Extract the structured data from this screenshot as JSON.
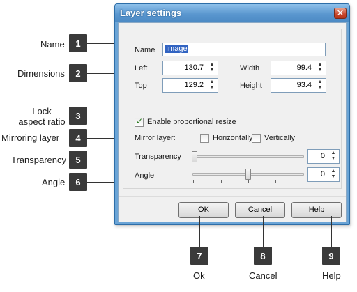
{
  "dialog": {
    "title": "Layer settings",
    "close_glyph": "✕",
    "name_label": "Name",
    "name_value": "Image",
    "left_label": "Left",
    "left_value": "130.7",
    "top_label": "Top",
    "top_value": "129.2",
    "width_label": "Width",
    "width_value": "99.4",
    "height_label": "Height",
    "height_value": "93.4",
    "proportional_label": "Enable proportional resize",
    "proportional_checked": true,
    "mirror_label": "Mirror layer:",
    "horizontally_label": "Horizontally",
    "vertically_label": "Vertically",
    "transparency_label": "Transparency",
    "transparency_value": "0",
    "angle_label": "Angle",
    "angle_value": "0",
    "ok_label": "OK",
    "cancel_label": "Cancel",
    "help_label": "Help"
  },
  "callouts": {
    "name": "Name",
    "dimensions": "Dimensions",
    "lock_line1": "Lock",
    "lock_line2": "aspect ratio",
    "mirroring": "Mirroring layer",
    "transparency": "Transparency",
    "angle": "Angle",
    "ok": "Ok",
    "cancel": "Cancel",
    "help": "Help"
  },
  "badges": [
    "1",
    "2",
    "3",
    "4",
    "5",
    "6",
    "7",
    "8",
    "9"
  ],
  "colors": {
    "titlebar": "#5a97cf",
    "badge": "#3a3a3a",
    "selection": "#3264c2"
  }
}
